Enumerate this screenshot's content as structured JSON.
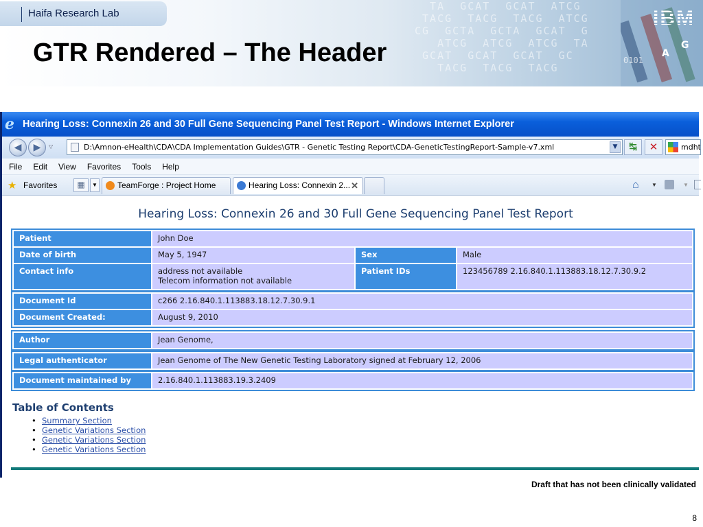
{
  "slide": {
    "lab_name": "Haifa Research Lab",
    "logo_text": "IBM",
    "title": "GTR Rendered – The Header",
    "footer_note": "Draft that has not been clinically validated",
    "page_number": "8"
  },
  "browser": {
    "window_title": "Hearing Loss: Connexin 26 and 30 Full Gene Sequencing Panel Test Report - Windows Internet Explorer",
    "address": "D:\\Amnon-eHealth\\CDA\\CDA Implementation Guides\\GTR - Genetic Testing Report\\CDA-GeneticTestingReport-Sample-v7.xml",
    "search_value": "mdht",
    "menu": [
      "File",
      "Edit",
      "View",
      "Favorites",
      "Tools",
      "Help"
    ],
    "favorites_label": "Favorites",
    "tabs": [
      {
        "label": "TeamForge : Project Home",
        "active": false
      },
      {
        "label": "Hearing Loss: Connexin 2...",
        "active": true
      }
    ],
    "icons": {
      "back": "back-arrow-icon",
      "forward": "forward-arrow-icon",
      "refresh": "refresh-icon",
      "stop": "stop-icon",
      "home": "home-icon",
      "rss": "rss-feed-icon",
      "favorites": "star-icon"
    }
  },
  "report": {
    "title": "Hearing Loss: Connexin 26 and 30 Full Gene Sequencing Panel Test Report",
    "patient_block": {
      "patient_label": "Patient",
      "patient_value": "John Doe",
      "dob_label": "Date of birth",
      "dob_value": "May 5, 1947",
      "sex_label": "Sex",
      "sex_value": "Male",
      "contact_label": "Contact info",
      "contact_line1": "address not available",
      "contact_line2": "Telecom information not available",
      "ids_label": "Patient IDs",
      "ids_value": "123456789 2.16.840.1.113883.18.12.7.30.9.2"
    },
    "document_block": {
      "id_label": "Document Id",
      "id_value": "c266 2.16.840.1.113883.18.12.7.30.9.1",
      "created_label": "Document Created:",
      "created_value": "August 9, 2010"
    },
    "author": {
      "label": "Author",
      "value": "Jean Genome,"
    },
    "legal": {
      "label": "Legal authenticator",
      "value": "Jean Genome of The New Genetic Testing Laboratory signed at February 12, 2006"
    },
    "maintained": {
      "label": "Document maintained by",
      "value": "2.16.840.1.113883.19.3.2409"
    },
    "toc_title": "Table of Contents",
    "toc_items": [
      "Summary Section",
      "Genetic Variations Section",
      "Genetic Variations Section",
      "Genetic Variations Section"
    ]
  },
  "colors": {
    "header_cell": "#3d8fe0",
    "value_cell": "#ccccff",
    "title_text": "#1e3f70",
    "rule": "#127a7a",
    "ie_titlebar": "#0750c8"
  }
}
